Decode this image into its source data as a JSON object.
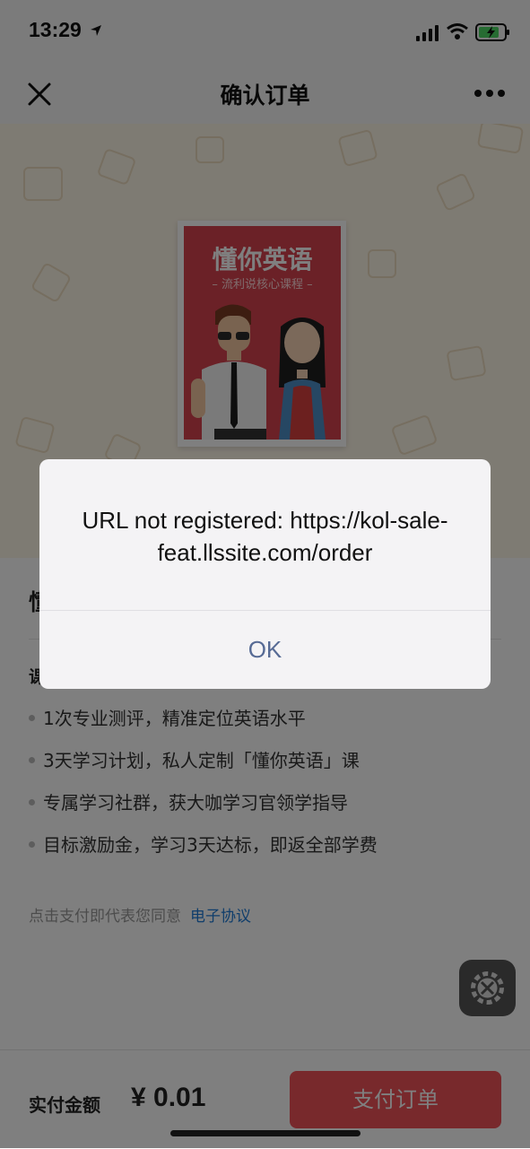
{
  "status_bar": {
    "time": "13:29"
  },
  "nav": {
    "title": "确认订单"
  },
  "hero": {
    "cover_title": "懂你英语",
    "cover_subtitle": "– 流利说核心课程 –"
  },
  "content": {
    "product_title_partial": "懂",
    "section_label_partial": "课",
    "features": [
      "1次专业测评，精准定位英语水平",
      "3天学习计划，私人定制「懂你英语」课",
      "专属学习社群，获大咖学习官领学指导",
      "目标激励金，学习3天达标，即返全部学费"
    ],
    "agreement_text": "点击支付即代表您同意",
    "agreement_link": "电子协议"
  },
  "bottom_bar": {
    "total_label": "实付金额",
    "total_amount": "¥ 0.01",
    "pay_label": "支付订单"
  },
  "dialog": {
    "message": "URL not registered: https://kol-sale-feat.llssite.com/order",
    "ok_label": "OK"
  },
  "colors": {
    "accent": "#f05258",
    "link": "#1e7bd6",
    "dialog_button": "#576b95",
    "hero_bg": "#fdf6e7"
  }
}
